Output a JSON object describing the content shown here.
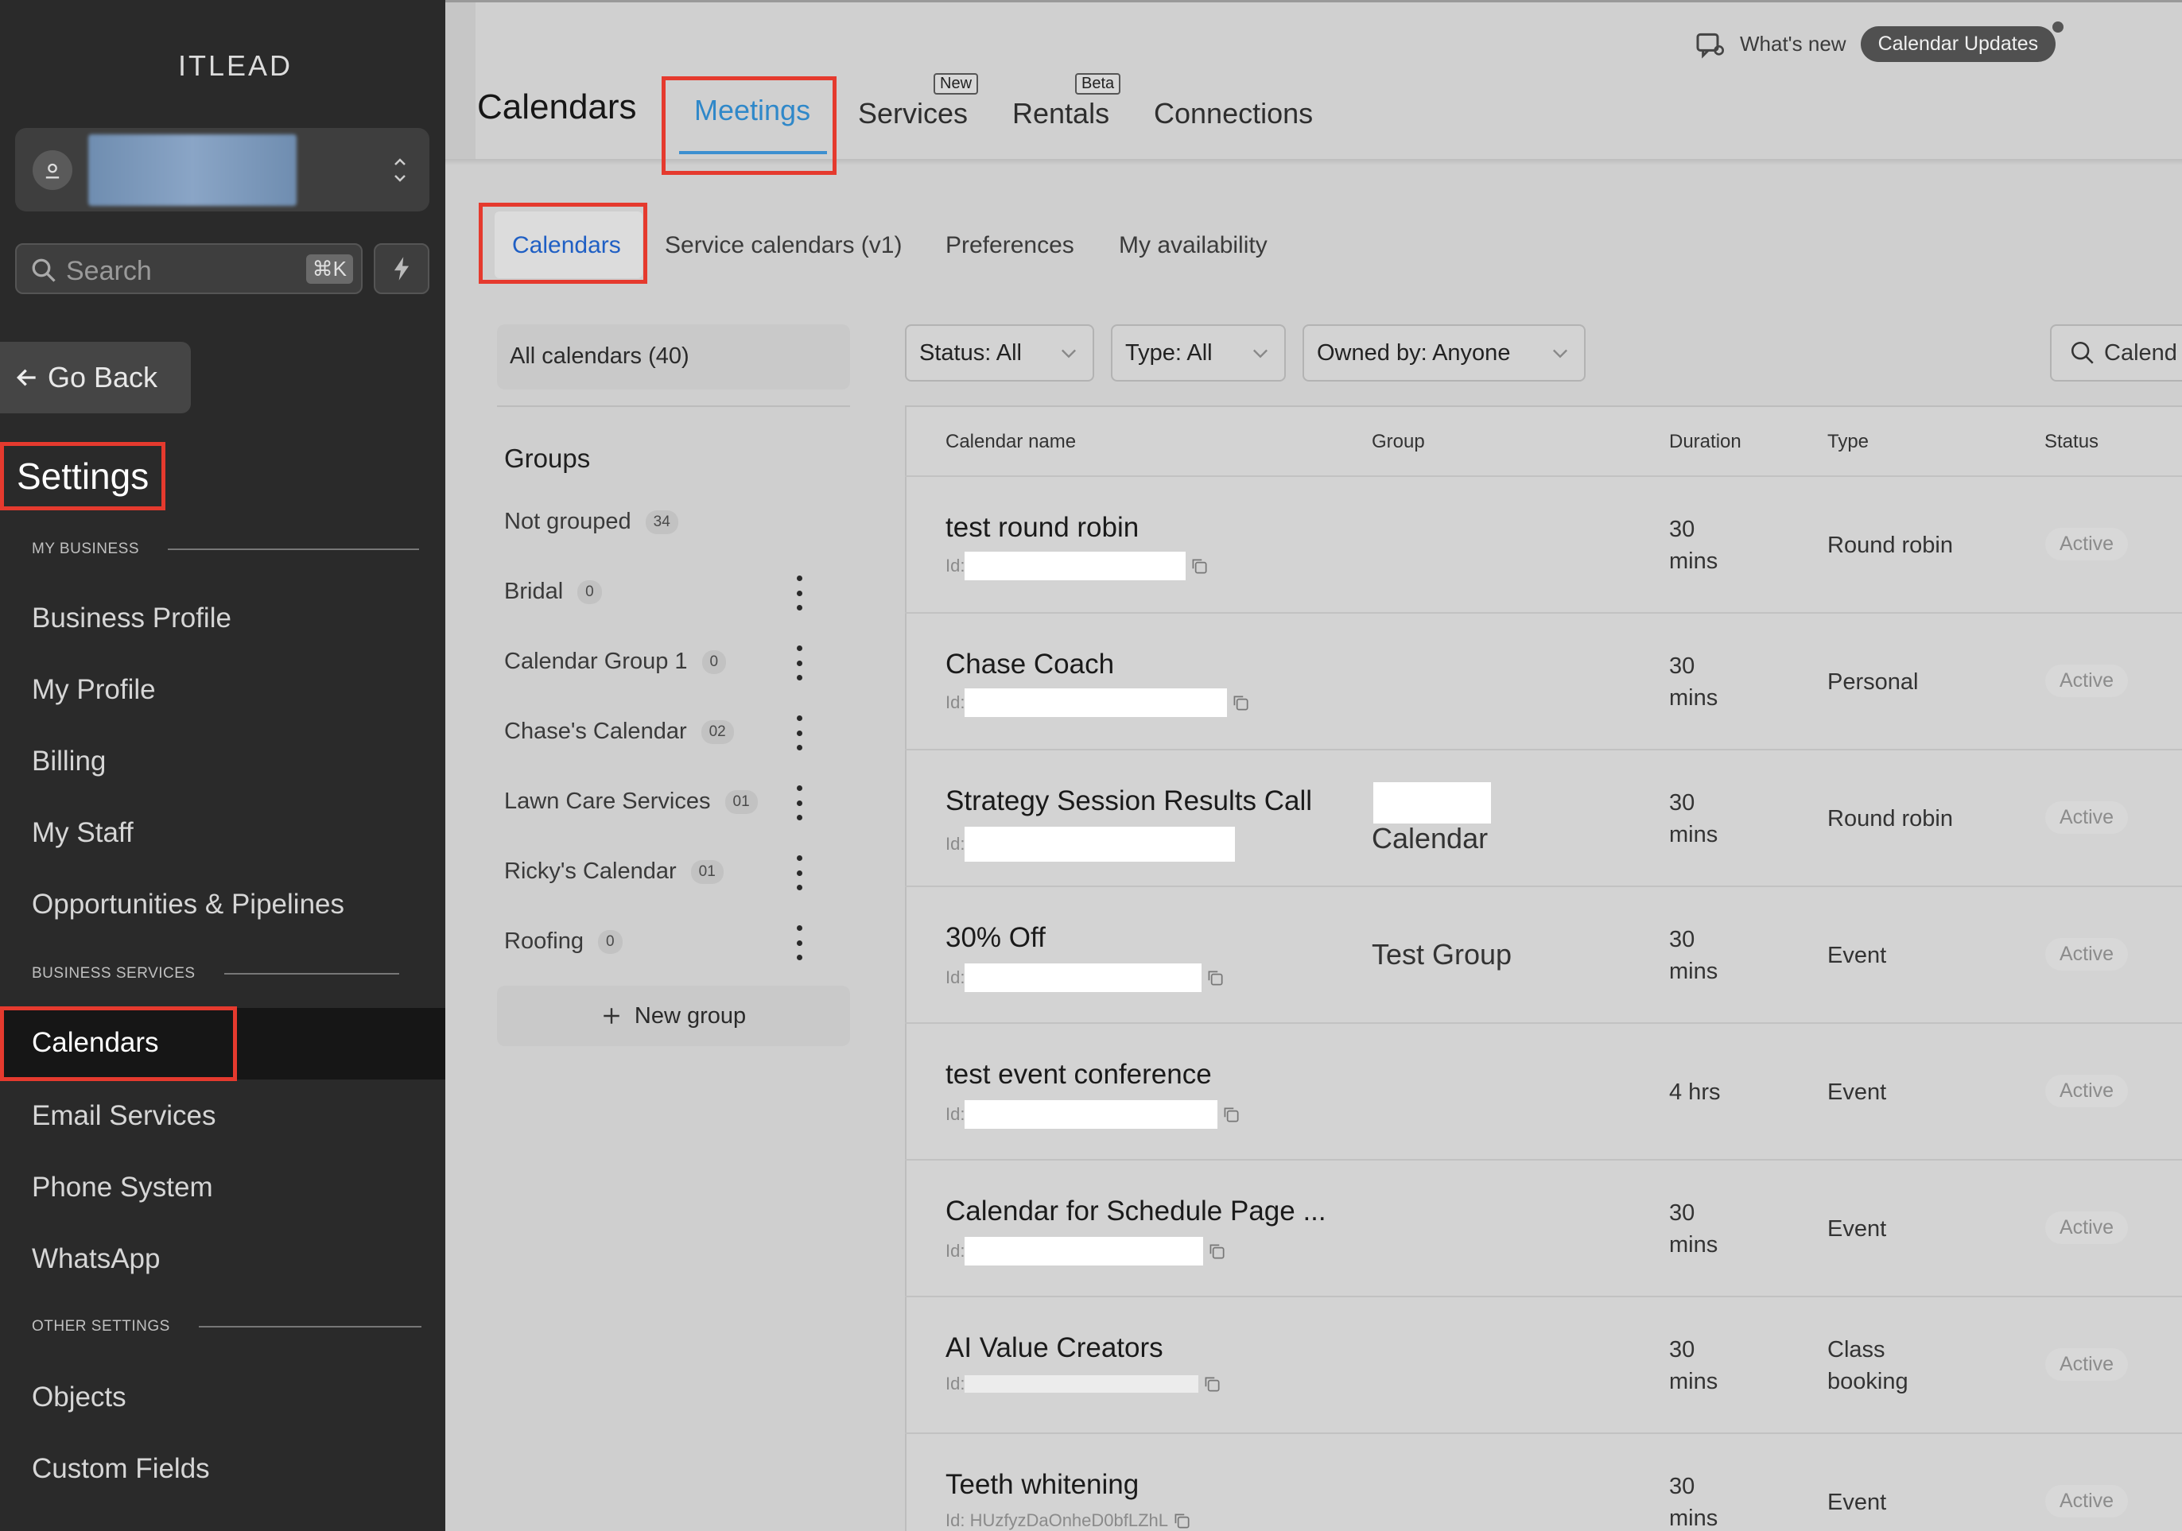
{
  "sidebar": {
    "brand": "ITLEAD",
    "search_label": "Search",
    "search_shortcut": "⌘K",
    "go_back": "Go Back",
    "settings_title": "Settings",
    "sections": {
      "my_business": "MY BUSINESS",
      "business_services": "BUSINESS SERVICES",
      "other_settings": "OTHER SETTINGS"
    },
    "items": {
      "business_profile": "Business Profile",
      "my_profile": "My Profile",
      "billing": "Billing",
      "my_staff": "My Staff",
      "opportunities": "Opportunities & Pipelines",
      "calendars": "Calendars",
      "email_services": "Email Services",
      "phone_system": "Phone System",
      "whatsapp": "WhatsApp",
      "objects": "Objects",
      "custom_fields": "Custom Fields"
    }
  },
  "header": {
    "whats_new": "What's new",
    "calendar_updates": "Calendar Updates",
    "title": "Calendars",
    "tabs": {
      "meetings": "Meetings",
      "services": "Services",
      "rentals": "Rentals",
      "connections": "Connections"
    },
    "badges": {
      "new": "New",
      "beta": "Beta"
    }
  },
  "subtabs": {
    "calendars": "Calendars",
    "service_calendars": "Service calendars (v1)",
    "preferences": "Preferences",
    "my_availability": "My availability"
  },
  "groups": {
    "all_calendars": "All calendars (40)",
    "title": "Groups",
    "list": [
      {
        "name": "Not grouped",
        "count": "34"
      },
      {
        "name": "Bridal",
        "count": "0"
      },
      {
        "name": "Calendar Group 1",
        "count": "0"
      },
      {
        "name": "Chase's Calendar",
        "count": "02"
      },
      {
        "name": "Lawn Care Services",
        "count": "01"
      },
      {
        "name": "Ricky's Calendar",
        "count": "01"
      },
      {
        "name": "Roofing",
        "count": "0"
      }
    ],
    "new_group": "New group"
  },
  "filters": {
    "status": "Status: All",
    "type": "Type: All",
    "owned_by": "Owned by: Anyone",
    "search_placeholder": "Calend"
  },
  "table": {
    "headers": {
      "name": "Calendar name",
      "group": "Group",
      "duration": "Duration",
      "type": "Type",
      "status": "Status"
    },
    "id_label": "Id:",
    "rows": [
      {
        "name": "test round robin",
        "group": "",
        "duration1": "30",
        "duration2": "mins",
        "type1": "Round robin",
        "type2": "",
        "status": "Active"
      },
      {
        "name": "Chase Coach",
        "group": "",
        "duration1": "30",
        "duration2": "mins",
        "type1": "Personal",
        "type2": "",
        "status": "Active"
      },
      {
        "name": "Strategy Session Results Call",
        "group": "Calendar",
        "duration1": "30",
        "duration2": "mins",
        "type1": "Round robin",
        "type2": "",
        "status": "Active"
      },
      {
        "name": "30% Off",
        "group": "Test Group",
        "duration1": "30",
        "duration2": "mins",
        "type1": "Event",
        "type2": "",
        "status": "Active"
      },
      {
        "name": "test event conference",
        "group": "",
        "duration1": "4 hrs",
        "duration2": "",
        "type1": "Event",
        "type2": "",
        "status": "Active"
      },
      {
        "name": "Calendar for Schedule Page ...",
        "group": "",
        "duration1": "30",
        "duration2": "mins",
        "type1": "Event",
        "type2": "",
        "status": "Active"
      },
      {
        "name": "AI Value Creators",
        "group": "",
        "duration1": "30",
        "duration2": "mins",
        "type1": "Class",
        "type2": "booking",
        "status": "Active"
      },
      {
        "name": "Teeth whitening",
        "group": "",
        "duration1": "30",
        "duration2": "mins",
        "type1": "Event",
        "type2": "",
        "status": "Active",
        "id_value": "Id: HUzfyzDaOnheD0bfLZhL"
      }
    ]
  }
}
